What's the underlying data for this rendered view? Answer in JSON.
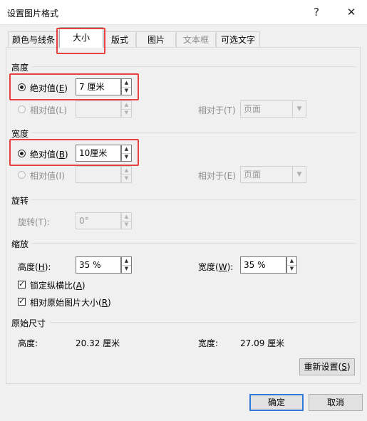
{
  "dialog": {
    "title": "设置图片格式",
    "help": "?",
    "close": "✕"
  },
  "tabs": [
    {
      "label": "颜色与线条"
    },
    {
      "label": "大小"
    },
    {
      "label": "版式"
    },
    {
      "label": "图片"
    },
    {
      "label": "文本框"
    },
    {
      "label": "可选文字"
    }
  ],
  "height": {
    "title": "高度",
    "absolute_label": "绝对值(",
    "absolute_key": "E",
    "absolute_value": "7 厘米",
    "relative_label": "相对值(L)",
    "relative_to_label": "相对于(T)",
    "relative_to_value": "页面"
  },
  "width": {
    "title": "宽度",
    "absolute_label": "绝对值(",
    "absolute_key": "B",
    "absolute_value": "10厘米",
    "relative_label": "相对值(I)",
    "relative_to_label": "相对于(E)",
    "relative_to_value": "页面"
  },
  "rotation": {
    "title": "旋转",
    "label": "旋转(T):",
    "value": "0°"
  },
  "scale": {
    "title": "缩放",
    "height_label": "高度(",
    "height_key": "H",
    "height_value": "35 %",
    "width_label": "宽度(",
    "width_key": "W",
    "width_value": "35 %",
    "lock_label": "锁定纵横比(",
    "lock_key": "A",
    "relative_label": "相对原始图片大小(",
    "relative_key": "R"
  },
  "original": {
    "title": "原始尺寸",
    "height_label": "高度:",
    "height_value": "20.32 厘米",
    "width_label": "宽度:",
    "width_value": "27.09 厘米",
    "reset_label": "重新设置(",
    "reset_key": "S"
  },
  "buttons": {
    "ok": "确定",
    "cancel": "取消"
  },
  "colors": {
    "highlight": "#e8403f",
    "primary_border": "#2f7ad9"
  },
  "icons": {
    "spin_up": "▲",
    "spin_down": "▼",
    "dropdown": "▼"
  }
}
